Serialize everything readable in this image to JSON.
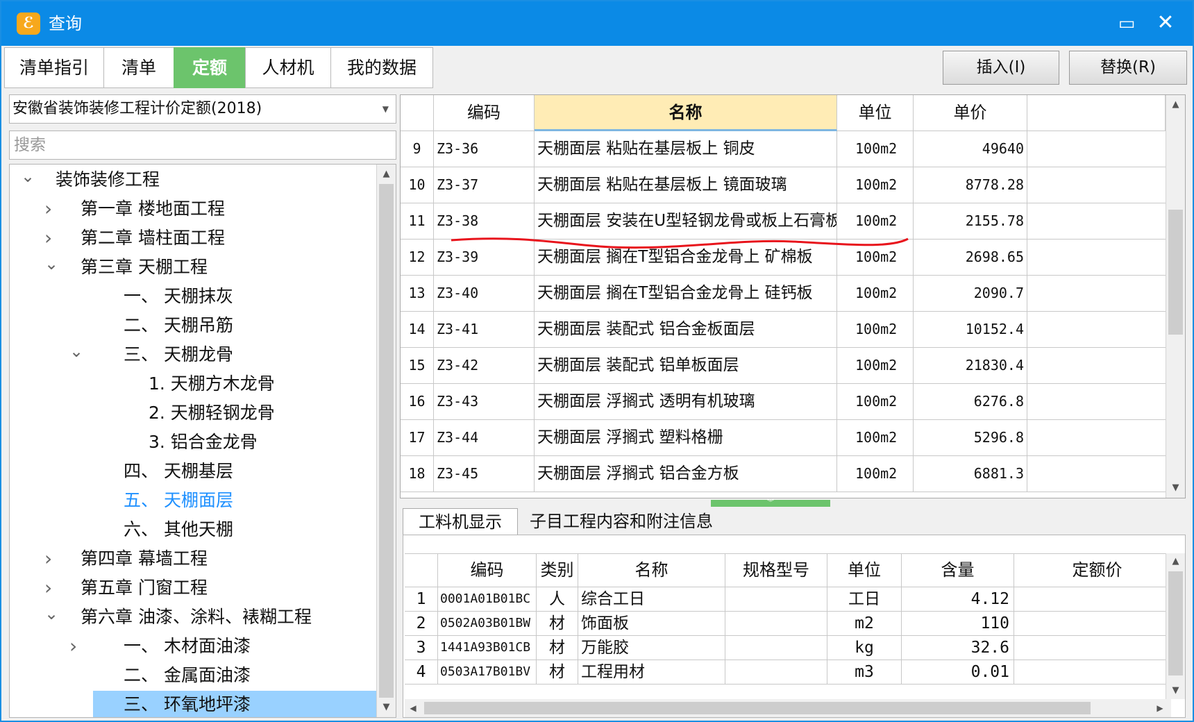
{
  "window": {
    "title": "查询"
  },
  "tabs": [
    {
      "label": "清单指引"
    },
    {
      "label": "清单"
    },
    {
      "label": "定额"
    },
    {
      "label": "人材机"
    },
    {
      "label": "我的数据"
    }
  ],
  "buttons": {
    "insert": "插入(I)",
    "replace": "替换(R)"
  },
  "left": {
    "combo_value": "安徽省装饰装修工程计价定额(2018)",
    "search_placeholder": "搜索",
    "tree": [
      {
        "label": "装饰装修工程",
        "toggle": "expanded"
      },
      {
        "label": "第一章 楼地面工程",
        "toggle": "collapsed"
      },
      {
        "label": "第二章 墙柱面工程",
        "toggle": "collapsed"
      },
      {
        "label": "第三章 天棚工程",
        "toggle": "expanded"
      },
      {
        "label": "一、 天棚抹灰",
        "toggle": "none"
      },
      {
        "label": "二、 天棚吊筋",
        "toggle": "none"
      },
      {
        "label": "三、 天棚龙骨",
        "toggle": "expanded"
      },
      {
        "label": "1. 天棚方木龙骨",
        "toggle": "none"
      },
      {
        "label": "2. 天棚轻钢龙骨",
        "toggle": "none"
      },
      {
        "label": "3. 铝合金龙骨",
        "toggle": "none"
      },
      {
        "label": "四、 天棚基层",
        "toggle": "none"
      },
      {
        "label": "五、 天棚面层",
        "toggle": "none",
        "current": true
      },
      {
        "label": "六、 其他天棚",
        "toggle": "none"
      },
      {
        "label": "第四章 幕墙工程",
        "toggle": "collapsed"
      },
      {
        "label": "第五章 门窗工程",
        "toggle": "collapsed"
      },
      {
        "label": "第六章 油漆、涂料、裱糊工程",
        "toggle": "expanded"
      },
      {
        "label": "一、 木材面油漆",
        "toggle": "collapsed"
      },
      {
        "label": "二、 金属面油漆",
        "toggle": "none"
      },
      {
        "label": "三、 环氧地坪漆",
        "toggle": "none",
        "selected": true
      }
    ]
  },
  "quota_grid": {
    "headers": [
      "编码",
      "名称",
      "单位",
      "单价"
    ],
    "rows": [
      {
        "no": "9",
        "code": "Z3-36",
        "name": "天棚面层 粘贴在基层板上 铜皮",
        "unit": "100m2",
        "price": "49640"
      },
      {
        "no": "10",
        "code": "Z3-37",
        "name": "天棚面层 粘贴在基层板上 镜面玻璃",
        "unit": "100m2",
        "price": "8778.28"
      },
      {
        "no": "11",
        "code": "Z3-38",
        "name": "天棚面层 安装在U型轻钢龙骨或板上石膏板",
        "unit": "100m2",
        "price": "2155.78"
      },
      {
        "no": "12",
        "code": "Z3-39",
        "name": "天棚面层 搁在T型铝合金龙骨上 矿棉板",
        "unit": "100m2",
        "price": "2698.65"
      },
      {
        "no": "13",
        "code": "Z3-40",
        "name": "天棚面层 搁在T型铝合金龙骨上 硅钙板",
        "unit": "100m2",
        "price": "2090.7"
      },
      {
        "no": "14",
        "code": "Z3-41",
        "name": "天棚面层 装配式 铝合金板面层",
        "unit": "100m2",
        "price": "10152.4"
      },
      {
        "no": "15",
        "code": "Z3-42",
        "name": "天棚面层 装配式 铝单板面层",
        "unit": "100m2",
        "price": "21830.4"
      },
      {
        "no": "16",
        "code": "Z3-43",
        "name": "天棚面层 浮搁式 透明有机玻璃",
        "unit": "100m2",
        "price": "6276.8"
      },
      {
        "no": "17",
        "code": "Z3-44",
        "name": "天棚面层 浮搁式 塑料格栅",
        "unit": "100m2",
        "price": "5296.8"
      },
      {
        "no": "18",
        "code": "Z3-45",
        "name": "天棚面层 浮搁式 铝合金方板",
        "unit": "100m2",
        "price": "6881.3"
      }
    ]
  },
  "bottom": {
    "tabs": [
      "工料机显示",
      "子目工程内容和附注信息"
    ],
    "headers": [
      "编码",
      "类别",
      "名称",
      "规格型号",
      "单位",
      "含量",
      "定额价"
    ],
    "rows": [
      {
        "no": "1",
        "code": "0001A01B01BC",
        "type": "人",
        "name": "综合工日",
        "spec": "",
        "unit": "工日",
        "qty": "4.12"
      },
      {
        "no": "2",
        "code": "0502A03B01BW",
        "type": "材",
        "name": "饰面板",
        "spec": "",
        "unit": "m2",
        "qty": "110"
      },
      {
        "no": "3",
        "code": "1441A93B01CB",
        "type": "材",
        "name": "万能胶",
        "spec": "",
        "unit": "kg",
        "qty": "32.6"
      },
      {
        "no": "4",
        "code": "0503A17B01BV",
        "type": "材",
        "name": "工程用材",
        "spec": "",
        "unit": "m3",
        "qty": "0.01"
      }
    ]
  },
  "colors": {
    "titlebar": "#0b8ae6",
    "active_tab": "#6cc46c",
    "tree_selected": "#99d1ff",
    "tree_current": "#1e90ff",
    "header_highlight": "#ffecb5",
    "annotation": "#e8141c"
  }
}
